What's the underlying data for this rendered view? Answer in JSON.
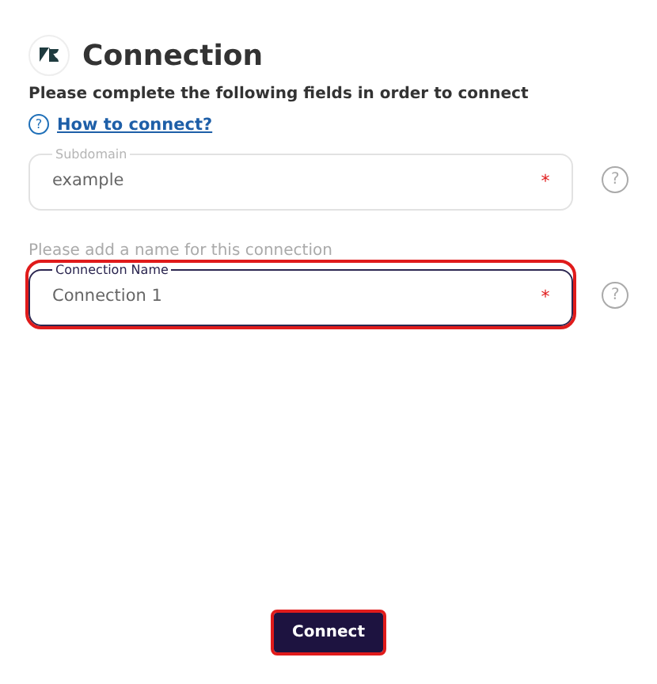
{
  "header": {
    "title": "Connection"
  },
  "instructions": "Please complete the following fields in order to connect",
  "help_link": {
    "icon": "?",
    "label": "How to connect?"
  },
  "fields": [
    {
      "label": "Subdomain",
      "value": "example",
      "required": "*",
      "help": "?",
      "focused": false,
      "highlighted": false
    },
    {
      "hint": "Please add a name for this connection",
      "label": "Connection Name",
      "value": "Connection 1",
      "required": "*",
      "help": "?",
      "focused": true,
      "highlighted": true
    }
  ],
  "connect_button": {
    "label": "Connect",
    "highlighted": true
  }
}
